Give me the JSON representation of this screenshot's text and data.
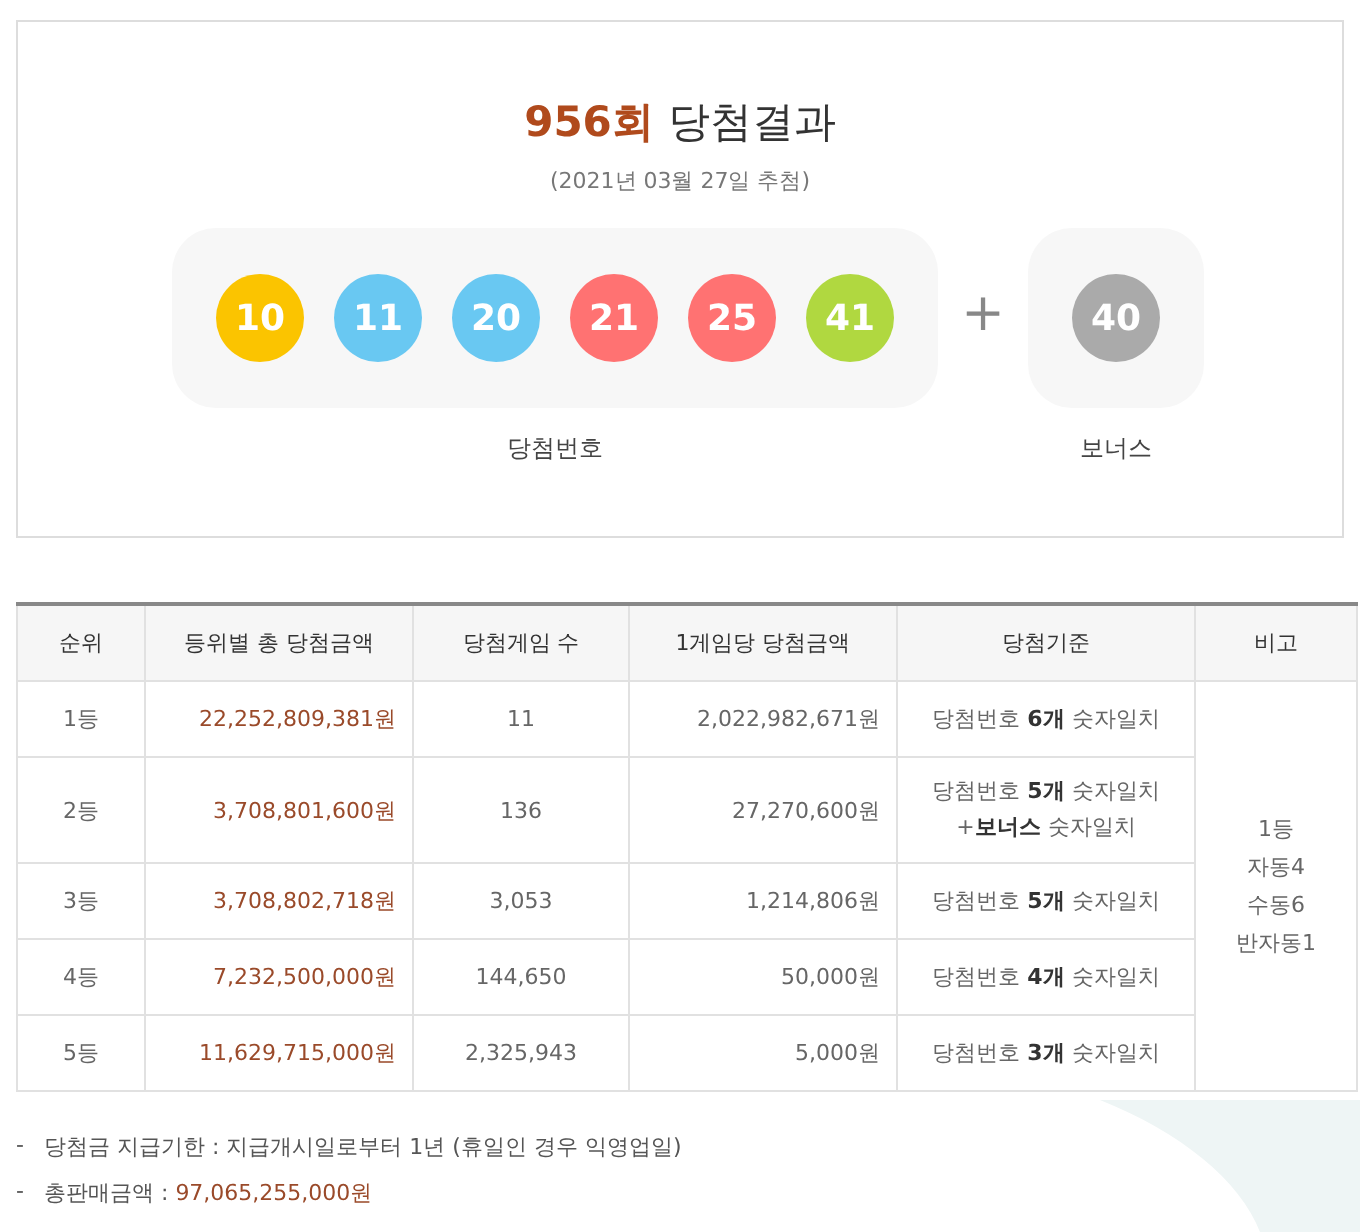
{
  "result": {
    "round": "956회",
    "title": "당첨결과",
    "draw_date": "(2021년 03월 27일 추첨)",
    "winning_numbers": [
      {
        "number": "10",
        "color": "#fbc400"
      },
      {
        "number": "11",
        "color": "#69c8f2"
      },
      {
        "number": "20",
        "color": "#69c8f2"
      },
      {
        "number": "21",
        "color": "#ff7272"
      },
      {
        "number": "25",
        "color": "#ff7272"
      },
      {
        "number": "41",
        "color": "#b0d840"
      }
    ],
    "plus": "+",
    "bonus": {
      "number": "40",
      "color": "#aaaaaa"
    },
    "winning_label": "당첨번호",
    "bonus_label": "보너스"
  },
  "table": {
    "columns": [
      "순위",
      "등위별 총 당첨금액",
      "당첨게임 수",
      "1게임당 당첨금액",
      "당첨기준",
      "비고"
    ],
    "rows": [
      {
        "rank": "1등",
        "total": "22,252,809,381원",
        "games": "11",
        "per_game": "2,022,982,671원",
        "criteria": "당첨번호 **6개** 숫자일치"
      },
      {
        "rank": "2등",
        "total": "3,708,801,600원",
        "games": "136",
        "per_game": "27,270,600원",
        "criteria": "당첨번호 **5개** 숫자일치\n+**보너스** 숫자일치"
      },
      {
        "rank": "3등",
        "total": "3,708,802,718원",
        "games": "3,053",
        "per_game": "1,214,806원",
        "criteria": "당첨번호 **5개** 숫자일치"
      },
      {
        "rank": "4등",
        "total": "7,232,500,000원",
        "games": "144,650",
        "per_game": "50,000원",
        "criteria": "당첨번호 **4개** 숫자일치"
      },
      {
        "rank": "5등",
        "total": "11,629,715,000원",
        "games": "2,325,943",
        "per_game": "5,000원",
        "criteria": "당첨번호 **3개** 숫자일치"
      }
    ],
    "note": "1등\n자동4\n수동6\n반자동1"
  },
  "notes": [
    {
      "marker": "-",
      "label": "당첨금 지급기한 :",
      "value": "지급개시일로부터 1년 (휴일인 경우 익영업일)",
      "highlight": false
    },
    {
      "marker": "-",
      "label": "총판매금액 :",
      "value": "97,065,255,000원",
      "highlight": true
    }
  ]
}
